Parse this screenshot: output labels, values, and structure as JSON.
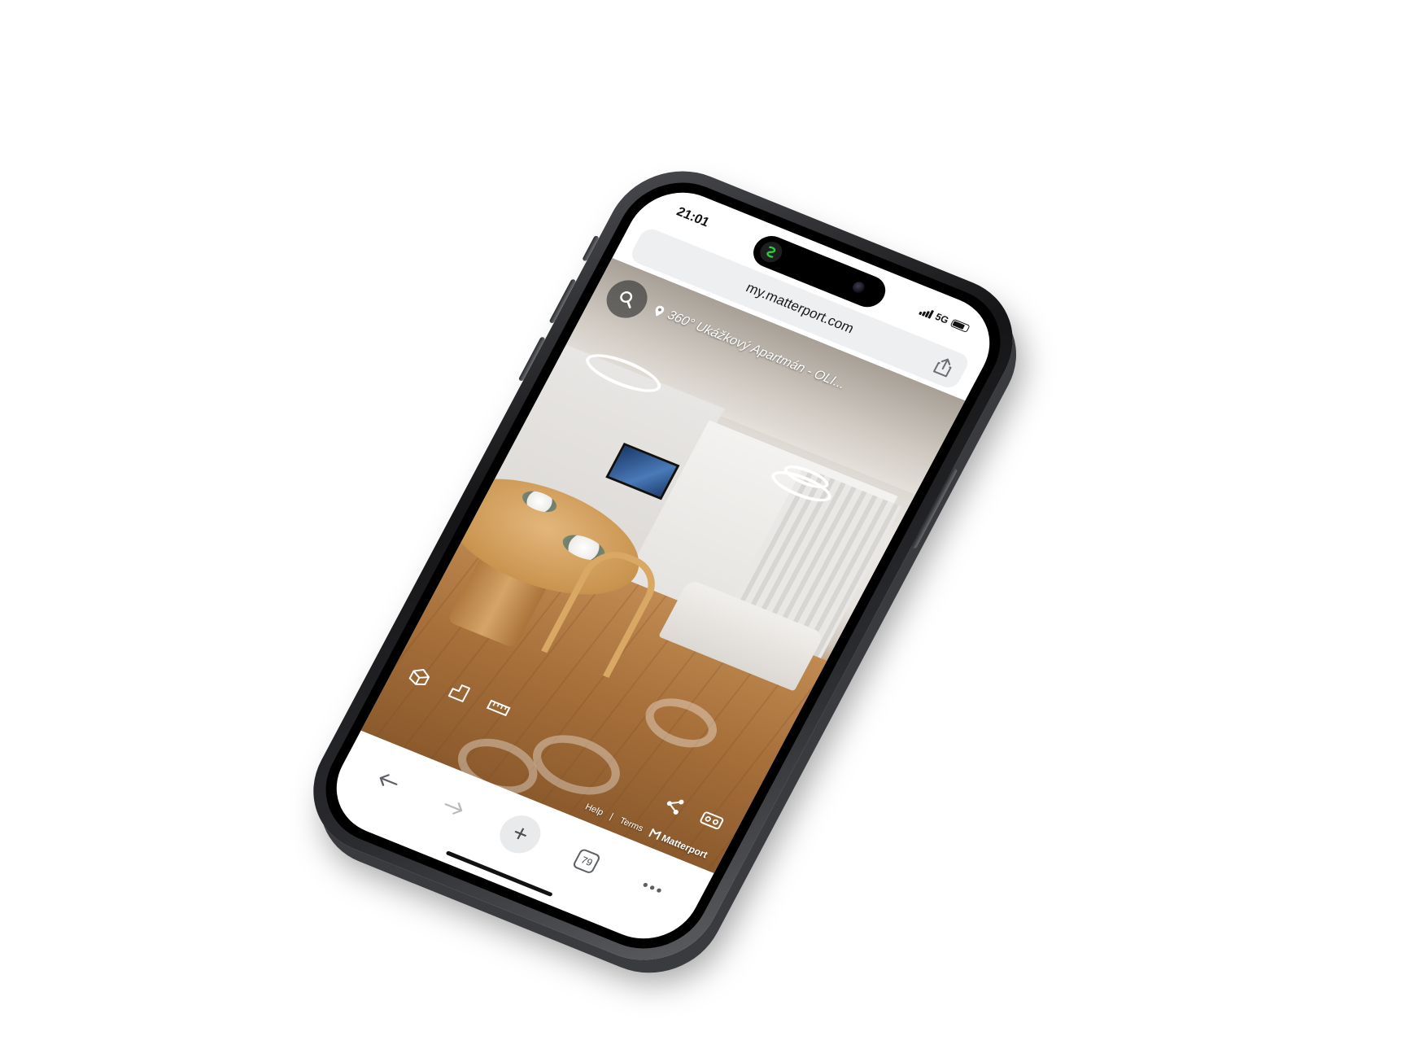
{
  "status": {
    "time": "21:01",
    "network": "5G"
  },
  "browser": {
    "url": "my.matterport.com",
    "tab_count": "79",
    "new_tab_label": "+",
    "back_icon": "arrow-left-icon",
    "forward_icon": "arrow-right-icon",
    "more_icon": "more-dots-icon",
    "share_icon": "share-icon"
  },
  "viewer": {
    "location_title": "360° Ukážkový Apartmán - OLI...",
    "tools": [
      "dollhouse-icon",
      "floorplan-icon",
      "measure-icon"
    ],
    "actions": [
      "share-icon",
      "vr-icon"
    ],
    "links": {
      "help": "Help",
      "separator": "|",
      "terms": "Terms",
      "brand": "Matterport"
    }
  },
  "colors": {
    "island_app_accent": "#2ecc40",
    "toolbar_icon": "#5c5f63",
    "address_bg": "#eeeff1"
  }
}
